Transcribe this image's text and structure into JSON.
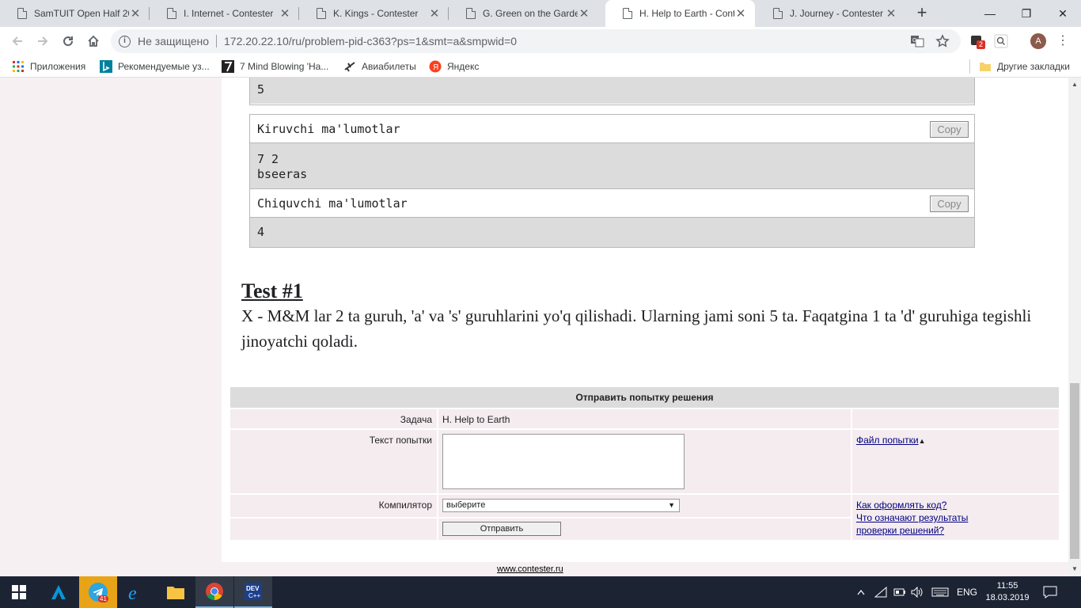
{
  "tabs": [
    {
      "title": "SamTUIT Open Half 2019",
      "active": false
    },
    {
      "title": "I. Internet - Contester",
      "active": false
    },
    {
      "title": "K. Kings - Contester",
      "active": false
    },
    {
      "title": "G. Green on the Garden",
      "active": false
    },
    {
      "title": "H. Help to Earth - Contester",
      "active": true
    },
    {
      "title": "J. Journey - Contester",
      "active": false
    }
  ],
  "window_controls": {
    "minimize": "—",
    "restore": "❐",
    "close": "✕"
  },
  "address_bar": {
    "security_label": "Не защищено",
    "url": "172.20.22.10/ru/problem-pid-c363?ps=1&smt=a&smpwid=0"
  },
  "extensions": {
    "badge": "2"
  },
  "profile": {
    "initial": "A"
  },
  "bookmarks": [
    {
      "label": "Приложения",
      "icon": "apps-grid-icon"
    },
    {
      "label": "Рекомендуемые уз...",
      "icon": "bing-icon"
    },
    {
      "label": "7 Mind Blowing 'Ha...",
      "icon": "bookmark-site-icon"
    },
    {
      "label": "Авиабилеты",
      "icon": "plane-icon"
    },
    {
      "label": "Яндекс",
      "icon": "yandex-icon"
    }
  ],
  "other_bookmarks": "Другие закладки",
  "samples": {
    "prev_output": "5",
    "input_label": "Kiruvchi ma'lumotlar",
    "input_value": "7 2\nbseeras",
    "output_label": "Chiquvchi ma'lumotlar",
    "output_value": "4",
    "copy_label": "Copy"
  },
  "test": {
    "title": "Test #1",
    "text": "X - M&M lar 2 ta guruh, 'a' va 's' guruhlarini yo'q qilishadi. Ularning jami soni 5 ta. Faqatgina 1 ta 'd' guruhiga tegishli jinoyatchi qoladi."
  },
  "submit_form": {
    "heading": "Отправить попытку решения",
    "task_label": "Задача",
    "task_value": "H. Help to Earth",
    "text_label": "Текст попытки",
    "file_link": "Файл попытки",
    "compiler_label": "Компилятор",
    "compiler_selected": "выберите",
    "send_button": "Отправить",
    "help_link_1": "Как оформлять код?",
    "help_link_2": "Что означают результаты проверки решений?"
  },
  "footer": {
    "link": "www.contester.ru"
  },
  "taskbar": {
    "telegram_badge": "41",
    "language": "ENG",
    "time": "11:55",
    "date": "18.03.2019"
  }
}
